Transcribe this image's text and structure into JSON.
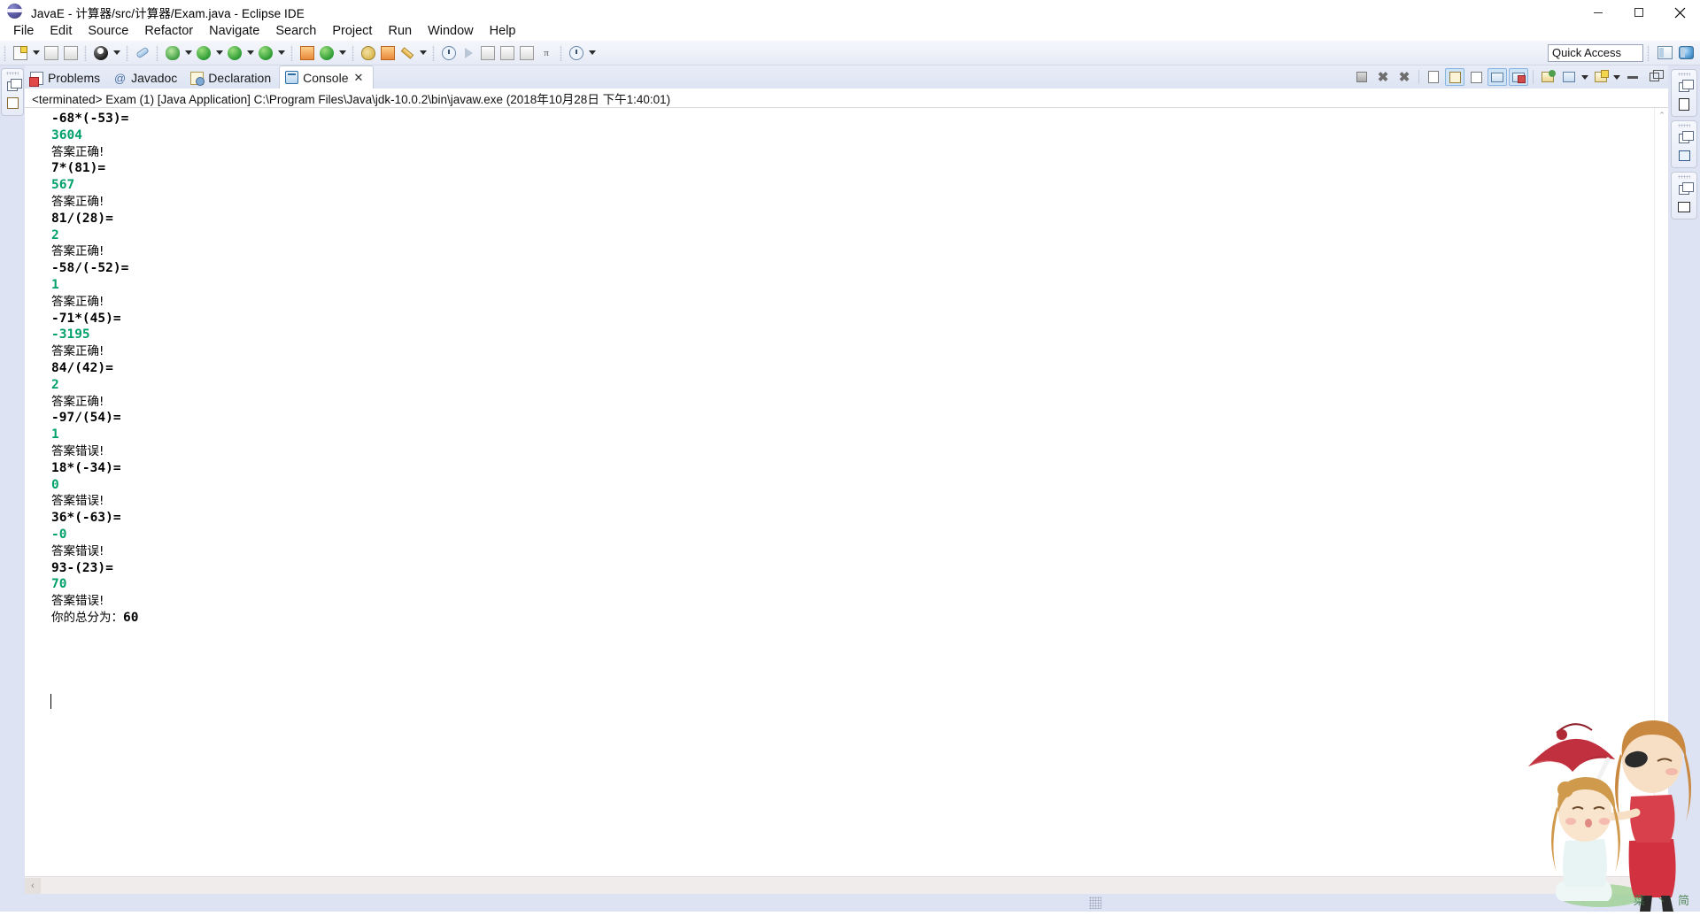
{
  "window": {
    "title": "JavaE - 计算器/src/计算器/Exam.java - Eclipse IDE",
    "app_icon": "eclipse-icon",
    "controls": {
      "minimize": "minimize-icon",
      "maximize": "maximize-icon",
      "close": "close-icon"
    }
  },
  "menubar": {
    "items": [
      {
        "label": "File"
      },
      {
        "label": "Edit"
      },
      {
        "label": "Source"
      },
      {
        "label": "Refactor"
      },
      {
        "label": "Navigate"
      },
      {
        "label": "Search"
      },
      {
        "label": "Project"
      },
      {
        "label": "Run"
      },
      {
        "label": "Window"
      },
      {
        "label": "Help"
      }
    ]
  },
  "toolbar": {
    "quick_access_placeholder": "Quick Access",
    "quick_access_value": "",
    "groups": [
      {
        "buttons": [
          {
            "icon": "new-wizard-icon",
            "has_arrow": true
          },
          {
            "icon": "save-icon",
            "has_arrow": false
          },
          {
            "icon": "save-all-icon",
            "has_arrow": false
          }
        ]
      },
      {
        "buttons": [
          {
            "icon": "print-icon",
            "has_arrow": true
          }
        ]
      },
      {
        "buttons": [
          {
            "icon": "link-break-icon",
            "has_arrow": false
          }
        ]
      },
      {
        "buttons": [
          {
            "icon": "debug-icon",
            "has_arrow": true
          }
        ]
      },
      {
        "buttons": [
          {
            "icon": "run-icon",
            "has_arrow": true
          },
          {
            "icon": "run-external-icon",
            "has_arrow": true
          },
          {
            "icon": "coverage-icon",
            "has_arrow": true
          }
        ]
      },
      {
        "buttons": [
          {
            "icon": "new-java-project-icon",
            "has_arrow": false
          },
          {
            "icon": "new-package-icon",
            "has_arrow": true
          }
        ]
      },
      {
        "buttons": [
          {
            "icon": "new-class-icon",
            "has_arrow": false
          },
          {
            "icon": "new-interface-icon",
            "has_arrow": false
          },
          {
            "icon": "new-annotation-icon",
            "has_arrow": true
          }
        ]
      },
      {
        "buttons": [
          {
            "icon": "search-icon",
            "has_arrow": false
          },
          {
            "icon": "next-annotation-icon",
            "has_arrow": false
          },
          {
            "icon": "last-edit-icon",
            "has_arrow": false
          },
          {
            "icon": "back-icon",
            "has_arrow": false
          },
          {
            "icon": "forward-icon",
            "has_arrow": false
          },
          {
            "icon": "pi-icon",
            "has_arrow": false
          }
        ]
      },
      {
        "buttons": [
          {
            "icon": "history-icon",
            "has_arrow": true
          }
        ]
      }
    ],
    "perspective_buttons": [
      {
        "icon": "open-perspective-icon"
      },
      {
        "icon": "java-perspective-icon"
      }
    ]
  },
  "view_tabs": [
    {
      "label": "Problems",
      "icon": "problems-icon",
      "active": false,
      "closable": false
    },
    {
      "label": "Javadoc",
      "icon": "javadoc-icon",
      "active": false,
      "closable": false
    },
    {
      "label": "Declaration",
      "icon": "declaration-icon",
      "active": false,
      "closable": false
    },
    {
      "label": "Console",
      "icon": "console-icon",
      "active": true,
      "closable": true,
      "close_glyph": "✕"
    }
  ],
  "console_toolbar": {
    "buttons": [
      {
        "icon": "terminate-icon",
        "toggled": false
      },
      {
        "icon": "remove-launch-icon",
        "toggled": false
      },
      {
        "icon": "remove-all-terminated-icon",
        "toggled": false
      },
      {
        "icon": "clear-console-icon",
        "toggled": false
      },
      {
        "icon": "scroll-lock-icon",
        "toggled": true
      },
      {
        "icon": "word-wrap-icon",
        "toggled": false
      },
      {
        "icon": "show-console-on-output-icon",
        "toggled": true
      },
      {
        "icon": "show-console-on-error-icon",
        "toggled": true
      },
      {
        "icon": "pin-console-icon",
        "toggled": false
      },
      {
        "icon": "display-selected-console-icon",
        "toggled": false,
        "has_arrow": true
      },
      {
        "icon": "open-console-icon",
        "toggled": false,
        "has_arrow": true
      },
      {
        "icon": "minimize-view-icon",
        "toggled": false
      },
      {
        "icon": "maximize-view-icon",
        "toggled": false
      }
    ]
  },
  "console": {
    "header": "<terminated> Exam (1) [Java Application] C:\\Program Files\\Java\\jdk-10.0.2\\bin\\javaw.exe (2018年10月28日 下午1:40:01)",
    "colors": {
      "expression": "#000000",
      "answer": "#00a06c",
      "status": "#000000",
      "background": "#ffffff"
    },
    "lines": [
      {
        "kind": "expr",
        "text": "-68*(-53)="
      },
      {
        "kind": "ans",
        "text": "3604"
      },
      {
        "kind": "status",
        "text": "答案正确!"
      },
      {
        "kind": "expr",
        "text": "7*(81)="
      },
      {
        "kind": "ans",
        "text": "567"
      },
      {
        "kind": "status",
        "text": "答案正确!"
      },
      {
        "kind": "expr",
        "text": "81/(28)="
      },
      {
        "kind": "ans",
        "text": "2"
      },
      {
        "kind": "status",
        "text": "答案正确!"
      },
      {
        "kind": "expr",
        "text": "-58/(-52)="
      },
      {
        "kind": "ans",
        "text": "1"
      },
      {
        "kind": "status",
        "text": "答案正确!"
      },
      {
        "kind": "expr",
        "text": "-71*(45)="
      },
      {
        "kind": "ans",
        "text": "-3195"
      },
      {
        "kind": "status",
        "text": "答案正确!"
      },
      {
        "kind": "expr",
        "text": "84/(42)="
      },
      {
        "kind": "ans",
        "text": "2"
      },
      {
        "kind": "status",
        "text": "答案正确!"
      },
      {
        "kind": "expr",
        "text": "-97/(54)="
      },
      {
        "kind": "ans",
        "text": "1"
      },
      {
        "kind": "status",
        "text": "答案错误!"
      },
      {
        "kind": "expr",
        "text": "18*(-34)="
      },
      {
        "kind": "ans",
        "text": "0"
      },
      {
        "kind": "status",
        "text": "答案错误!"
      },
      {
        "kind": "expr",
        "text": "36*(-63)="
      },
      {
        "kind": "ans",
        "text": "-0"
      },
      {
        "kind": "status",
        "text": "答案错误!"
      },
      {
        "kind": "expr",
        "text": "93-(23)="
      },
      {
        "kind": "ans",
        "text": "70"
      },
      {
        "kind": "status",
        "text": "答案错误!"
      },
      {
        "kind": "total",
        "text": "你的总分为：60"
      }
    ]
  },
  "scrollbars": {
    "vertical_up_glyph": "⌃",
    "horizontal_left_glyph": "‹"
  },
  "left_fastview": {
    "tabs": [
      {
        "icon": "restore-icon",
        "secondary_icon": "package-explorer-icon"
      }
    ]
  },
  "right_fastview": {
    "tabs": [
      {
        "icon": "restore-icon",
        "secondary_icon": "outline-document-icon"
      },
      {
        "icon": "restore-icon",
        "secondary_icon": "task-list-icon"
      },
      {
        "icon": "restore-icon",
        "secondary_icon": "panel-layout-icon"
      }
    ]
  },
  "watermark": {
    "description": "two-girls-with-red-umbrella-illustration",
    "caption": "菜 丶 简"
  }
}
